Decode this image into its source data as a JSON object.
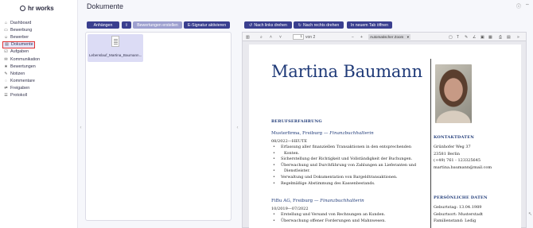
{
  "app": {
    "logo_text": "hr works"
  },
  "sidebar": {
    "items": [
      {
        "label": "Dashboard",
        "icon": "home-icon"
      },
      {
        "label": "Bewerbung",
        "icon": "document-icon"
      },
      {
        "label": "Bewerber",
        "icon": "user-icon"
      },
      {
        "label": "Dokumente",
        "icon": "folder-icon",
        "active": true
      },
      {
        "label": "Aufgaben",
        "icon": "checkbox-icon"
      },
      {
        "label": "Kommunikation",
        "icon": "chat-icon"
      },
      {
        "label": "Bewertungen",
        "icon": "star-icon"
      },
      {
        "label": "Notizen",
        "icon": "pencil-icon"
      },
      {
        "label": "Kommentare",
        "icon": "comment-icon"
      },
      {
        "label": "Freigaben",
        "icon": "share-icon"
      },
      {
        "label": "Protokoll",
        "icon": "log-icon"
      }
    ]
  },
  "header": {
    "title": "Dokumente"
  },
  "toolbar": {
    "attach_label": "Anhängen",
    "ratings_label": "Bewertungen erstellen",
    "esign_label": "E-Signatur aktivieren",
    "rotate_left_label": "Nach links drehen",
    "rotate_right_label": "Nach rechts drehen",
    "new_tab_label": "In neuem Tab öffnen"
  },
  "documents": [
    {
      "filename": "Lebenslauf_Martina_Baumann..."
    }
  ],
  "pdf_viewer": {
    "page_current": "1",
    "page_total_label": "von 2",
    "zoom_label": "Automatischer Zoom"
  },
  "cv": {
    "name": "Martina Baumann",
    "experience_heading": "BERUFSERFAHRUNG",
    "jobs": [
      {
        "company": "Musterfirma,",
        "city": "Freiburg —",
        "role": "Finanzbuchhalterin",
        "date": "08/2022—HEUTE",
        "bullets": [
          "Erfassung aller finanziellen Transaktionen in den entsprechenden",
          "Konten.",
          "Sicherstellung der Richtigkeit und Vollständigkeit der Buchungen.",
          "Überwachung und Durchführung von Zahlungen an Lieferanten und",
          "Dienstleister.",
          "Verwaltung und Dokumentation von Bargeldtransaktionen.",
          "Regelmäßige Abstimmung des Kassenbestands."
        ]
      },
      {
        "company": "FiBu AG,",
        "city": "Freiburg —",
        "role": "Finanzbuchhalterin",
        "date": "10/2019—07/2022",
        "bullets": [
          "Erstellung und Versand von Rechnungen an Kunden.",
          "Überwachung offener Forderungen und Mahnwesen."
        ]
      }
    ],
    "contact_heading": "KONTAKTDATEN",
    "contact_lines": [
      "Grünhofer Weg 37",
      "23581 Berlin",
      "(+49) 761 - 123325645",
      "martina.baumann@mail.com"
    ],
    "personal_heading": "PERSÖNLICHE DATEN",
    "personal_lines": [
      "Geburtstag: 13.04.1989",
      "Geburtsort: Musterstadt",
      "Familienstand: Ledig"
    ]
  },
  "colors": {
    "accent": "#3a3f8f",
    "cv_blue": "#1f3a78",
    "active_border": "#dd3333"
  }
}
